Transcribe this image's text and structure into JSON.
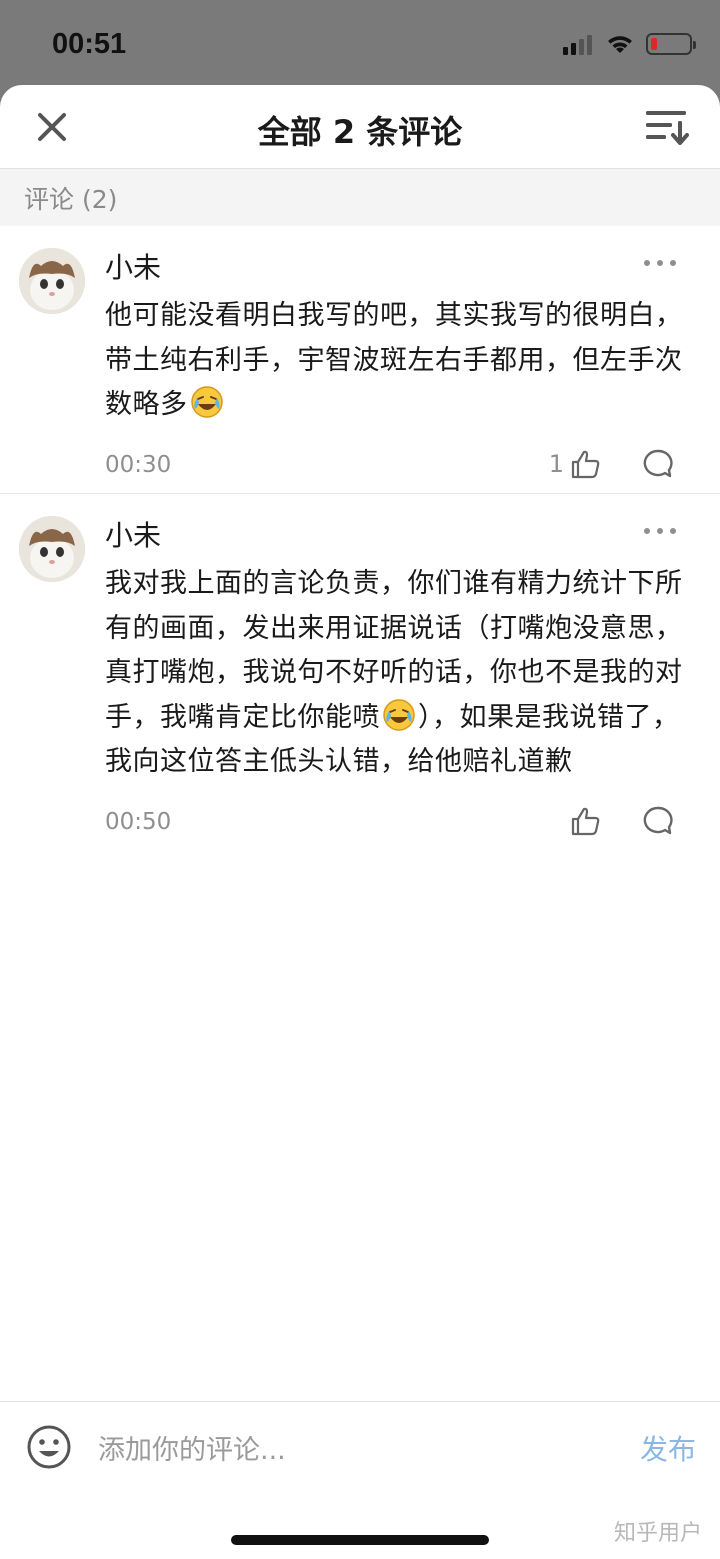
{
  "status_bar": {
    "time": "00:51"
  },
  "header": {
    "title": "全部 2 条评论"
  },
  "section": {
    "label": "评论 (2)"
  },
  "comments": [
    {
      "author": "小未",
      "text_parts": [
        "他可能没看明白我写的吧，其实我写的很明白，带土纯右利手，宇智波斑左右手都用，但左手次数略多",
        ""
      ],
      "emojis": [
        "laughing-crying-emoji"
      ],
      "time": "00:30",
      "likes": "1"
    },
    {
      "author": "小未",
      "text_parts": [
        "我对我上面的言论负责，你们谁有精力统计下所有的画面，发出来用证据说话（打嘴炮没意思，真打嘴炮，我说句不好听的话，你也不是我的对手，我嘴肯定比你能喷",
        "），如果是我说错了，我向这位答主低头认错，给他赔礼道歉"
      ],
      "emojis": [
        "laughing-crying-emoji"
      ],
      "time": "00:50",
      "likes": ""
    }
  ],
  "footer": {
    "placeholder": "添加你的评论...",
    "publish": "发布"
  },
  "watermark": "知乎用户",
  "colors": {
    "accent": "#8ab8e6",
    "battery_low": "#e0262b"
  }
}
